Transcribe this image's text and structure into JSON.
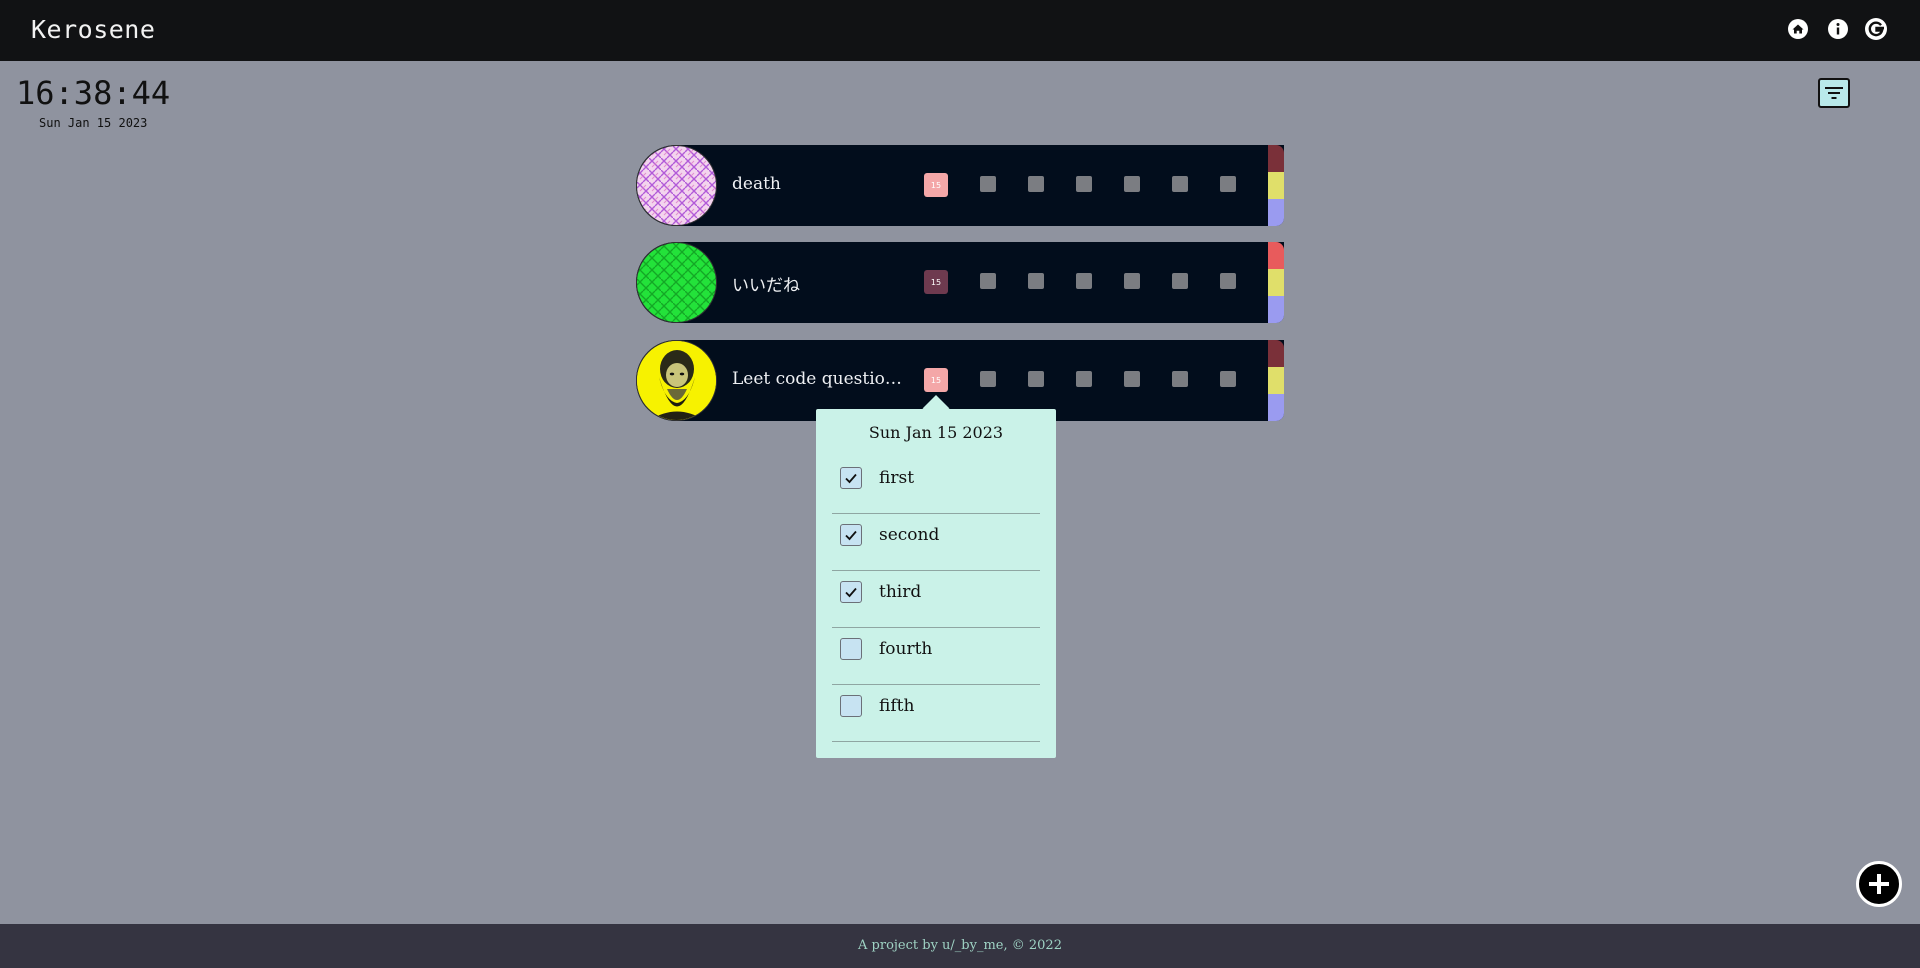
{
  "header": {
    "app_title": "Kerosene",
    "icons": [
      "home-icon",
      "info-icon",
      "account-icon"
    ]
  },
  "clock": {
    "time": "16:38:44",
    "date": "Sun Jan 15 2023"
  },
  "filter": {
    "icon": "filter-icon"
  },
  "habits": [
    {
      "name": "death",
      "today": "15",
      "today_color": "#f4a7a8",
      "avatar": "pink-maze-pattern",
      "strip": [
        "#7a3039",
        "#e0df6a",
        "#9a9bf0"
      ]
    },
    {
      "name": "いいだね",
      "today": "15",
      "today_color": "#6e3a4f",
      "avatar": "green-maze-pattern",
      "strip": [
        "#e85b5c",
        "#e0df6a",
        "#9a9bf0"
      ]
    },
    {
      "name": "Leet code questions",
      "today": "15",
      "today_color": "#f4a7a8",
      "avatar": "bearded-man-portrait",
      "strip": [
        "#7a3039",
        "#e0df6a",
        "#9a9bf0"
      ]
    }
  ],
  "popover": {
    "title": "Sun Jan 15 2023",
    "todos": [
      {
        "label": "first",
        "checked": true
      },
      {
        "label": "second",
        "checked": true
      },
      {
        "label": "third",
        "checked": true
      },
      {
        "label": "fourth",
        "checked": false
      },
      {
        "label": "fifth",
        "checked": false
      }
    ]
  },
  "fab": {
    "icon": "plus-icon"
  },
  "footer": {
    "text": "A project by u/_by_me, © 2022"
  }
}
